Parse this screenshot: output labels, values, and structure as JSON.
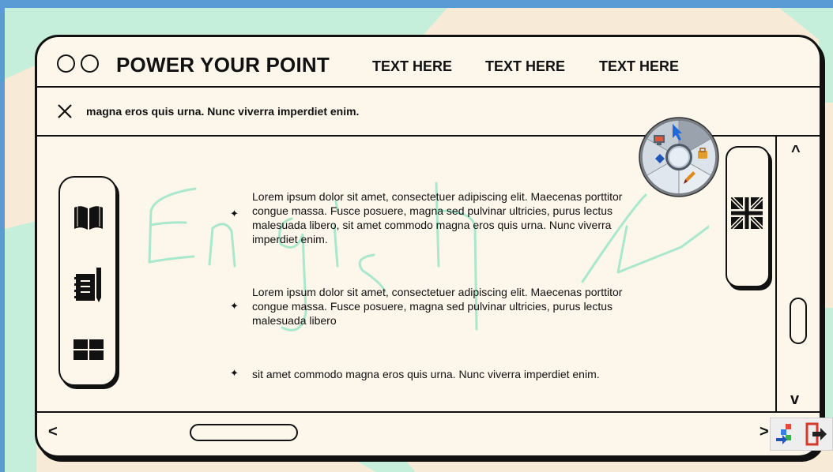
{
  "window": {
    "title": "POWER YOUR POINT",
    "nav": [
      "TEXT HERE",
      "TEXT HERE",
      "TEXT HERE"
    ]
  },
  "notice": {
    "close_icon": "x-icon",
    "text": "magna eros quis urna. Nunc viverra imperdiet enim."
  },
  "content": {
    "items": [
      {
        "text": "Lorem ipsum dolor sit amet, consectetuer adipiscing elit. Maecenas porttitor congue massa. Fusce posuere, magna sed pulvinar ultricies, purus lectus malesuada libero, sit amet commodo magna eros quis urna. Nunc viverra imperdiet enim."
      },
      {
        "text": "Lorem ipsum dolor sit amet, consectetuer adipiscing elit. Maecenas porttitor congue massa. Fusce posuere, magna sed pulvinar ultricies, purus lectus malesuada libero"
      },
      {
        "text": "sit amet commodo magna eros quis urna. Nunc viverra imperdiet enim."
      }
    ],
    "handwriting": "English"
  },
  "left_toolbar": [
    "book-icon",
    "notebook-pen-icon",
    "table-icon"
  ],
  "right_toolbar": [
    "uk-flag-icon"
  ],
  "scrollbars": {
    "up": "^",
    "down": "v",
    "left": "<",
    "right": ">"
  },
  "colors": {
    "mint": "#c5eedb",
    "cream": "#fdf6ea",
    "beige": "#f7ead7",
    "ink": "#111111",
    "handwriting": "#a9e8cc"
  }
}
